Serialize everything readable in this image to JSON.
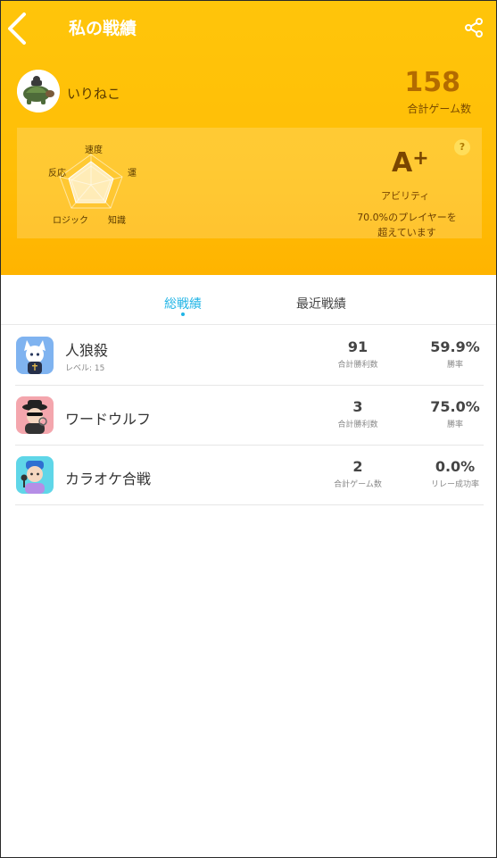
{
  "header": {
    "title": "私の戦績",
    "back_icon": "chevron-left-icon",
    "share_icon": "share-icon",
    "background_color": "#ffc107"
  },
  "profile": {
    "username": "いりねこ",
    "total_games": "158",
    "total_games_label": "合計ゲーム数"
  },
  "ability": {
    "radar_labels": {
      "speed": "速度",
      "luck": "運",
      "knowledge": "知識",
      "logic": "ロジック",
      "reaction": "反応"
    },
    "grade": "A",
    "grade_suffix": "+",
    "grade_label": "アビリティ",
    "percentile_line1": "70.0%のプレイヤーを",
    "percentile_line2": "超えています",
    "help": "?"
  },
  "tabs": [
    {
      "label": "総戦績",
      "active": true
    },
    {
      "label": "最近戦績",
      "active": false
    }
  ],
  "games": [
    {
      "name": "人狼殺",
      "level": "レベル: 15",
      "stat1_value": "91",
      "stat1_label": "合計勝利数",
      "stat2_value": "59.9%",
      "stat2_label": "勝率",
      "icon": "werewolf-icon"
    },
    {
      "name": "ワードウルフ",
      "stat1_value": "3",
      "stat1_label": "合計勝利数",
      "stat2_value": "75.0%",
      "stat2_label": "勝率",
      "icon": "spy-icon"
    },
    {
      "name": "カラオケ合戦",
      "stat1_value": "2",
      "stat1_label": "合計ゲーム数",
      "stat2_value": "0.0%",
      "stat2_label": "リレー成功率",
      "icon": "karaoke-icon"
    }
  ],
  "colors": {
    "accent": "#1fb4e6",
    "header_gold": "#ffc107",
    "count_brown": "#b36b00"
  }
}
